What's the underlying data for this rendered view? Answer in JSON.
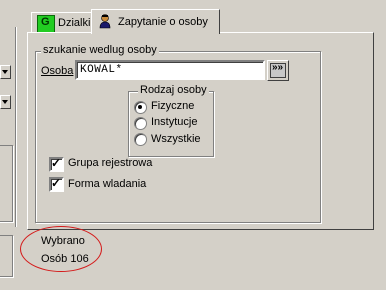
{
  "tabs": [
    {
      "label": "Dzialki",
      "icon": "green-g-icon"
    },
    {
      "label": "Zapytanie o osoby",
      "icon": "person-icon"
    }
  ],
  "search_group": {
    "legend": "szukanie wedlug osoby",
    "osoba_label": "Osoba",
    "osoba_value": "KOWAL*",
    "browse_icon": "dots-icon"
  },
  "person_type": {
    "legend": "Rodzaj osoby",
    "options": [
      "Fizyczne",
      "Instytucje",
      "Wszystkie"
    ],
    "selected": "Fizyczne"
  },
  "checkboxes": [
    {
      "label": "Grupa rejestrowa",
      "checked": true
    },
    {
      "label": "Forma wladania",
      "checked": true
    }
  ],
  "result": {
    "label": "Wybrano",
    "count_text": "Osób 106"
  },
  "colors": {
    "annotation": "#d41a1a",
    "face": "#d4d0c8"
  }
}
